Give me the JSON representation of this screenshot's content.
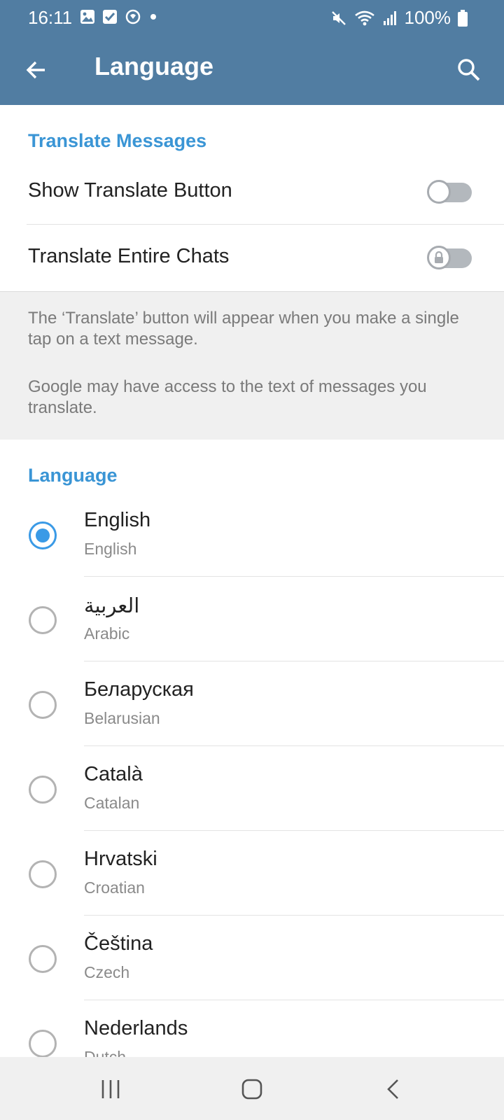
{
  "status": {
    "time": "16:11",
    "battery": "100%",
    "left_icons": [
      "gallery-icon",
      "checkbox-icon",
      "sync-icon",
      "dot-icon"
    ],
    "right_icons": [
      "mute-icon",
      "wifi-icon",
      "signal-icon",
      "battery-icon"
    ]
  },
  "appbar": {
    "title": "Language",
    "back_icon": "back-arrow-icon",
    "search_icon": "search-icon",
    "background": "#517da2"
  },
  "translate": {
    "header": "Translate Messages",
    "show_button_label": "Show Translate Button",
    "show_button_on": false,
    "entire_chats_label": "Translate Entire Chats",
    "entire_chats_on": false,
    "entire_chats_locked": true,
    "info_1": "The ‘Translate’ button will appear when you make a single tap on a text message.",
    "info_2": "Google may have access to the text of messages you translate."
  },
  "language": {
    "header": "Language",
    "accent": "#3a95d5",
    "items": [
      {
        "name": "English",
        "sub": "English",
        "selected": true
      },
      {
        "name": "العربية",
        "sub": "Arabic",
        "selected": false
      },
      {
        "name": "Беларуская",
        "sub": "Belarusian",
        "selected": false
      },
      {
        "name": "Català",
        "sub": "Catalan",
        "selected": false
      },
      {
        "name": "Hrvatski",
        "sub": "Croatian",
        "selected": false
      },
      {
        "name": "Čeština",
        "sub": "Czech",
        "selected": false
      },
      {
        "name": "Nederlands",
        "sub": "Dutch",
        "selected": false
      }
    ]
  },
  "navbar": {
    "icons": [
      "recent-apps-icon",
      "home-icon",
      "back-nav-icon"
    ]
  }
}
